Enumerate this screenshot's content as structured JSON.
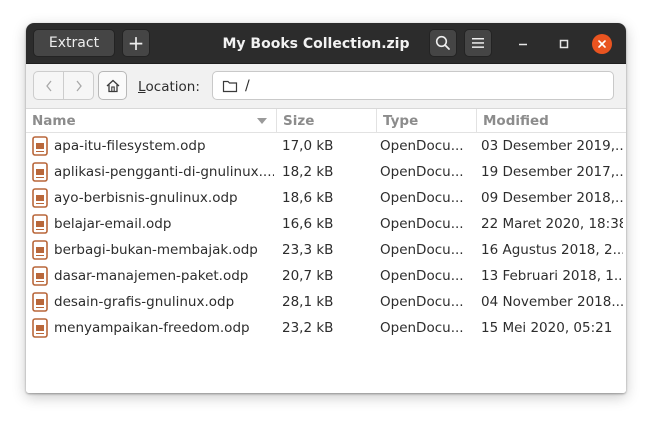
{
  "window": {
    "title": "My Books Collection.zip"
  },
  "headerbar": {
    "extract_label": "Extract",
    "new_label": "+"
  },
  "toolbar": {
    "location_label_accel": "L",
    "location_label_rest": "ocation:",
    "location_value": "/"
  },
  "columns": {
    "name": "Name",
    "size": "Size",
    "type": "Type",
    "modified": "Modified"
  },
  "files": [
    {
      "name": "apa-itu-filesystem.odp",
      "size": "17,0 kB",
      "type": "OpenDocu...",
      "modified": "03 Desember 2019,..."
    },
    {
      "name": "aplikasi-pengganti-di-gnulinux....",
      "size": "18,2 kB",
      "type": "OpenDocu...",
      "modified": "19 Desember 2017,..."
    },
    {
      "name": "ayo-berbisnis-gnulinux.odp",
      "size": "18,6 kB",
      "type": "OpenDocu...",
      "modified": "09 Desember 2018,..."
    },
    {
      "name": "belajar-email.odp",
      "size": "16,6 kB",
      "type": "OpenDocu...",
      "modified": "22 Maret 2020, 18:38"
    },
    {
      "name": "berbagi-bukan-membajak.odp",
      "size": "23,3 kB",
      "type": "OpenDocu...",
      "modified": "16 Agustus 2018, 2..."
    },
    {
      "name": "dasar-manajemen-paket.odp",
      "size": "20,7 kB",
      "type": "OpenDocu...",
      "modified": "13 Februari 2018, 1..."
    },
    {
      "name": "desain-grafis-gnulinux.odp",
      "size": "28,1 kB",
      "type": "OpenDocu...",
      "modified": "04 November 2018..."
    },
    {
      "name": "menyampaikan-freedom.odp",
      "size": "23,2 kB",
      "type": "OpenDocu...",
      "modified": "15 Mei 2020, 05:21"
    }
  ],
  "icons": {
    "file": "presentation-file-icon",
    "search": "search-icon",
    "menu": "hamburger-menu-icon",
    "back": "chevron-left-icon",
    "forward": "chevron-right-icon",
    "home": "home-icon",
    "folder": "folder-icon",
    "minimize": "minimize-icon",
    "maximize": "maximize-icon",
    "close": "close-icon"
  },
  "colors": {
    "headerbar": "#2c2c2c",
    "close_button": "#e95420",
    "file_icon": "#b9673a"
  }
}
